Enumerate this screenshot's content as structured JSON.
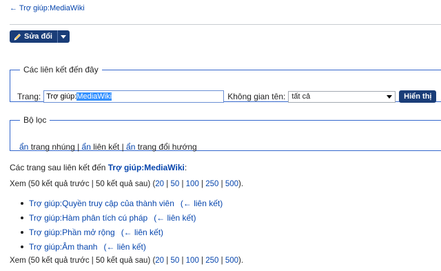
{
  "back_link": "← Trợ giúp:MediaWiki",
  "toolbar": {
    "edit_label": "Sửa đổi"
  },
  "links_here": {
    "legend": "Các liên kết đến đây",
    "page_label": "Trang:",
    "page_value_prefix": "Trợ giúp:",
    "page_value_selected": "MediaWiki",
    "namespace_label": "Không gian tên:",
    "namespace_value": "tất cả",
    "show_button": "Hiển thị"
  },
  "filter": {
    "legend": "Bộ lọc",
    "hide_transclusions": "ẩn",
    "transclusions_text": " trang nhúng | ",
    "hide_links": "ẩn",
    "links_text": " liên kết | ",
    "hide_redirects": "ẩn",
    "redirects_text": " trang đổi hướng"
  },
  "intro": {
    "text": "Các trang sau liên kết đến ",
    "target": "Trợ giúp:MediaWiki",
    "colon": ":"
  },
  "pagination": {
    "prefix": "Xem (50 kết quả trước | 50 kết quả sau) (",
    "options": [
      "20",
      "50",
      "100",
      "250",
      "500"
    ],
    "separator": " | ",
    "suffix": ")."
  },
  "results": [
    {
      "title": "Trợ giúp:Quyền truy cập của thành viên",
      "links": "(← liên kết)"
    },
    {
      "title": "Trợ giúp:Hàm phân tích cú pháp",
      "links": "(← liên kết)"
    },
    {
      "title": "Trợ giúp:Phần mở rộng",
      "links": "(← liên kết)"
    },
    {
      "title": "Trợ giúp:Âm thanh",
      "links": "(← liên kết)"
    }
  ]
}
